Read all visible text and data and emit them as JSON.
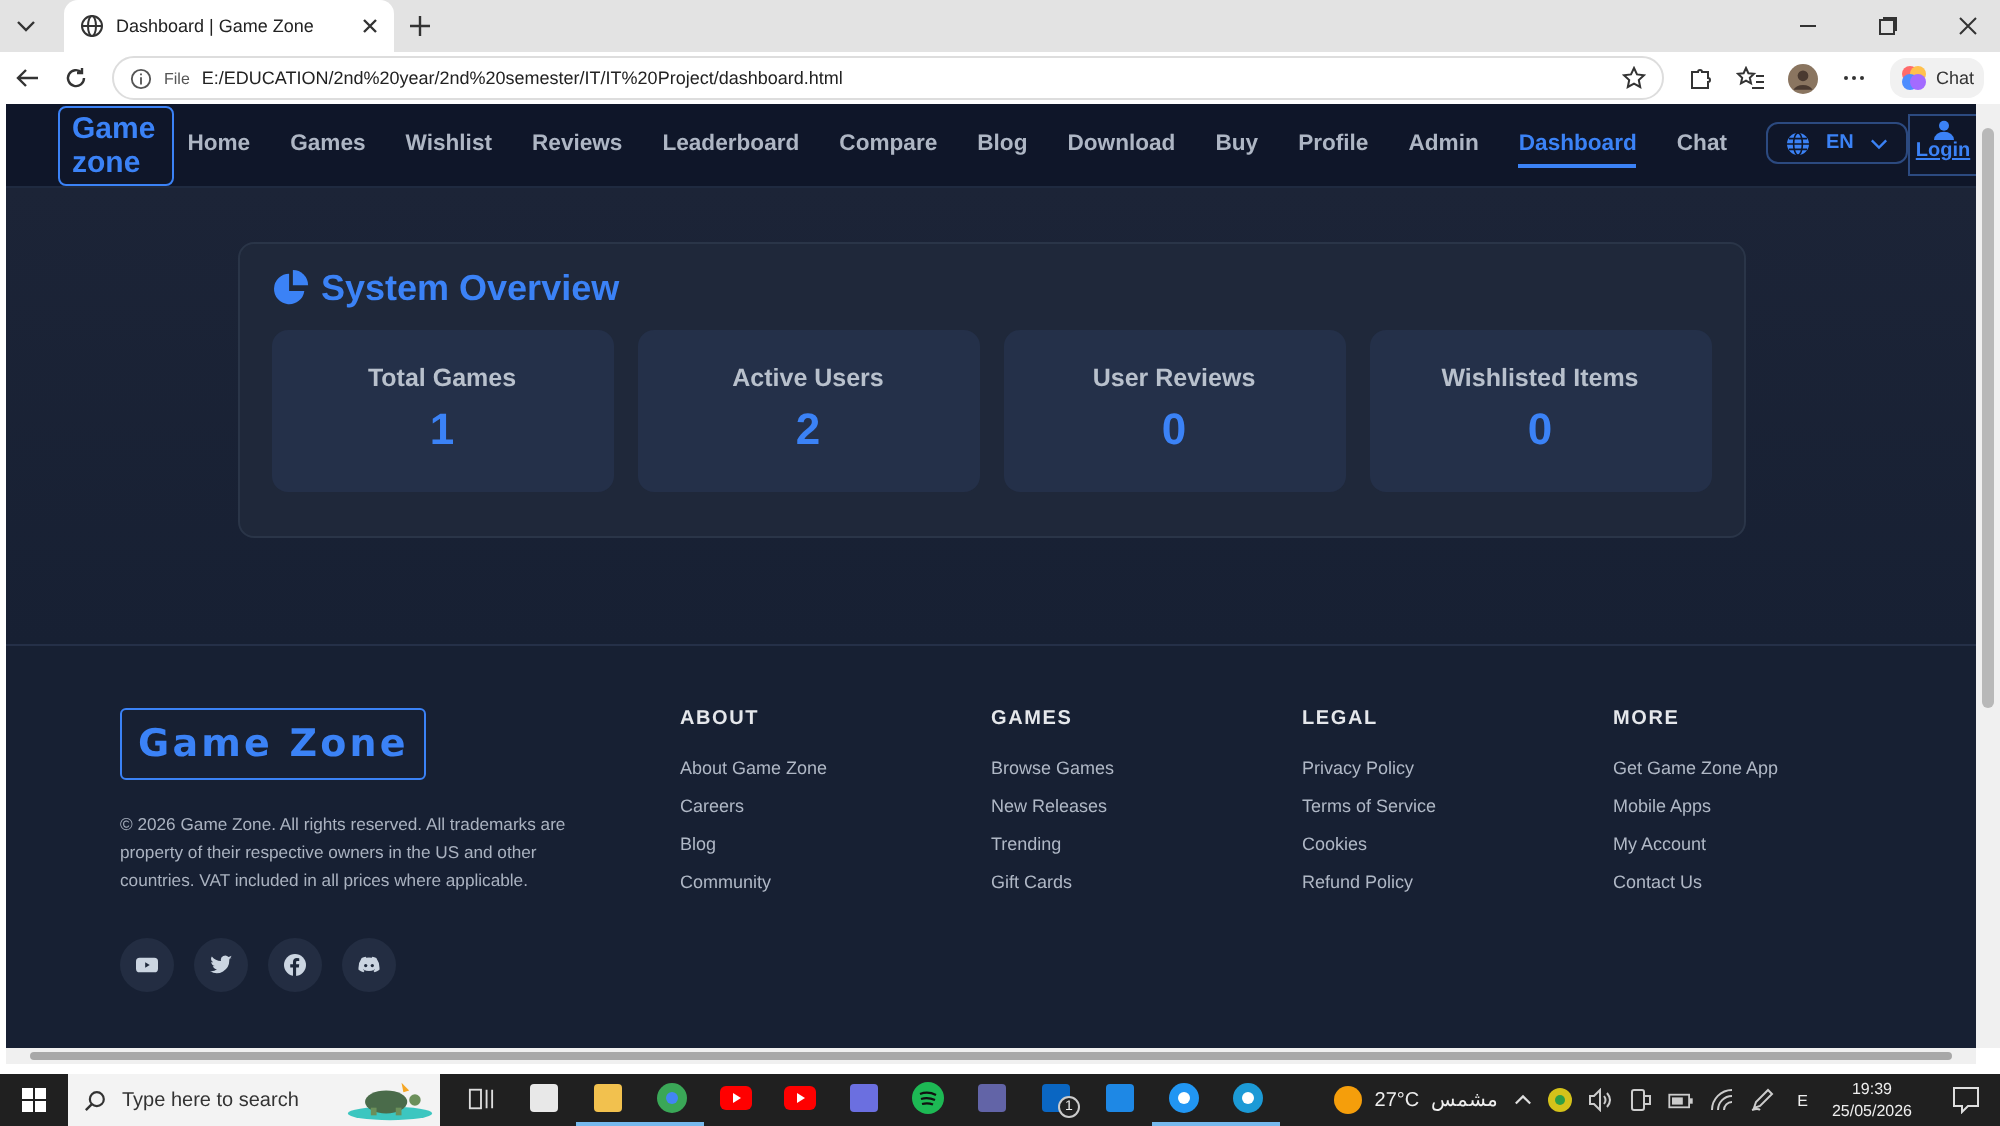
{
  "browser": {
    "tab_title": "Dashboard | Game Zone",
    "address_prefix": "File",
    "url": "E:/EDUCATION/2nd%20year/2nd%20semester/IT/IT%20Project/dashboard.html",
    "chat_label": "Chat"
  },
  "nav": {
    "logo": "Game zone",
    "items": [
      {
        "label": "Home",
        "selected": false
      },
      {
        "label": "Games",
        "selected": false
      },
      {
        "label": "Wishlist",
        "selected": false
      },
      {
        "label": "Reviews",
        "selected": false
      },
      {
        "label": "Leaderboard",
        "selected": false
      },
      {
        "label": "Compare",
        "selected": false
      },
      {
        "label": "Blog",
        "selected": false
      },
      {
        "label": "Download",
        "selected": false
      },
      {
        "label": "Buy",
        "selected": false
      },
      {
        "label": "Profile",
        "selected": false
      },
      {
        "label": "Admin",
        "selected": false
      },
      {
        "label": "Dashboard",
        "selected": true
      },
      {
        "label": "Chat",
        "selected": false
      }
    ],
    "language": "EN",
    "login": "Login"
  },
  "overview": {
    "title": "System Overview",
    "stats": [
      {
        "label": "Total Games",
        "value": "1"
      },
      {
        "label": "Active Users",
        "value": "2"
      },
      {
        "label": "User Reviews",
        "value": "0"
      },
      {
        "label": "Wishlisted Items",
        "value": "0"
      }
    ]
  },
  "footer": {
    "logo": "Game Zone",
    "copyright": "© 2026 Game Zone. All rights reserved. All trademarks are property of their respective owners in the US and other countries. VAT included in all prices where applicable.",
    "socials": [
      {
        "kind": "youtube"
      },
      {
        "kind": "twitter"
      },
      {
        "kind": "facebook"
      },
      {
        "kind": "discord"
      }
    ],
    "columns": [
      {
        "heading": "ABOUT",
        "links": [
          "About Game Zone",
          "Careers",
          "Blog",
          "Community"
        ]
      },
      {
        "heading": "GAMES",
        "links": [
          "Browse Games",
          "New Releases",
          "Trending",
          "Gift Cards"
        ]
      },
      {
        "heading": "LEGAL",
        "links": [
          "Privacy Policy",
          "Terms of Service",
          "Cookies",
          "Refund Policy"
        ]
      },
      {
        "heading": "MORE",
        "links": [
          "Get Game Zone App",
          "Mobile Apps",
          "My Account",
          "Contact Us"
        ]
      }
    ]
  },
  "taskbar": {
    "search_placeholder": "Type here to search",
    "apps": [
      {
        "kind": "taskview",
        "running": false
      },
      {
        "kind": "store",
        "running": false
      },
      {
        "kind": "files",
        "running": true
      },
      {
        "kind": "chrome",
        "running": true
      },
      {
        "kind": "youtube-app",
        "running": false
      },
      {
        "kind": "youtube",
        "running": false
      },
      {
        "kind": "tool",
        "running": false
      },
      {
        "kind": "spotify",
        "running": false
      },
      {
        "kind": "teams",
        "running": false
      },
      {
        "kind": "linkedin",
        "running": false,
        "badge": "1"
      },
      {
        "kind": "board",
        "running": false
      },
      {
        "kind": "ring",
        "running": true
      },
      {
        "kind": "edge",
        "running": true
      }
    ],
    "temperature": "27°C",
    "weather": "مشمس",
    "input_language": "E",
    "time": "19:39",
    "date": "25/05/2026"
  }
}
